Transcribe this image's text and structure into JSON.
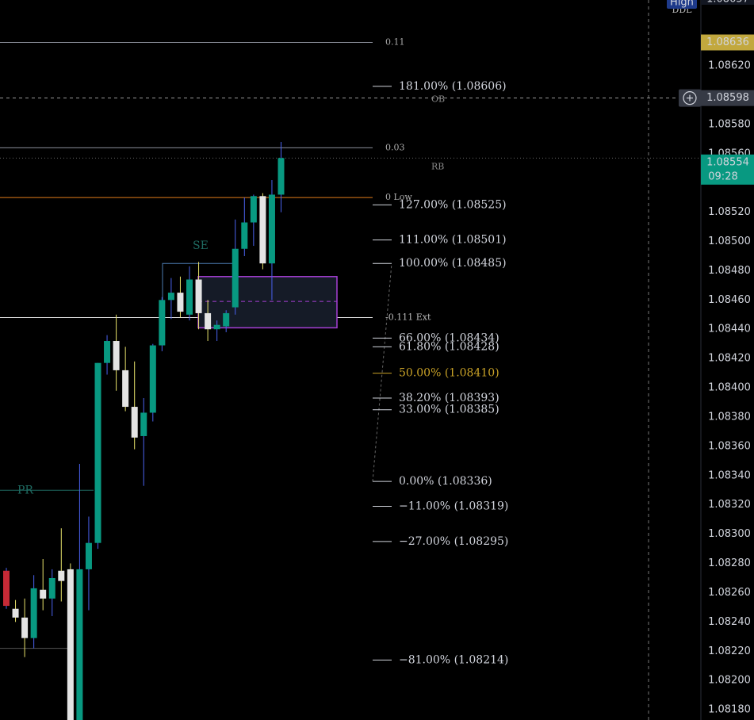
{
  "chart_data": {
    "type": "candlestick",
    "price_range": [
      1.08173,
      1.08665
    ],
    "y_ticks": [
      "1.08620",
      "1.08580",
      "1.08560",
      "1.08520",
      "1.08500",
      "1.08480",
      "1.08460",
      "1.08440",
      "1.08420",
      "1.08400",
      "1.08380",
      "1.08360",
      "1.08340",
      "1.08320",
      "1.08300",
      "1.08280",
      "1.08260",
      "1.08240",
      "1.08220",
      "1.08200",
      "1.08180"
    ],
    "candles": [
      {
        "o": 1.08275,
        "h": 1.08277,
        "l": 1.08249,
        "c": 1.08251,
        "color": "red"
      },
      {
        "o": 1.08249,
        "h": 1.08255,
        "l": 1.0824,
        "c": 1.08243,
        "color": "white"
      },
      {
        "o": 1.08243,
        "h": 1.08256,
        "l": 1.08216,
        "c": 1.08229,
        "color": "white"
      },
      {
        "o": 1.08229,
        "h": 1.08272,
        "l": 1.08222,
        "c": 1.08263,
        "color": "green"
      },
      {
        "o": 1.08262,
        "h": 1.08283,
        "l": 1.08248,
        "c": 1.08256,
        "color": "white"
      },
      {
        "o": 1.08256,
        "h": 1.08276,
        "l": 1.08244,
        "c": 1.0827,
        "color": "green"
      },
      {
        "o": 1.08268,
        "h": 1.08304,
        "l": 1.08254,
        "c": 1.08275,
        "color": "white"
      },
      {
        "o": 1.08276,
        "h": 1.0828,
        "l": 1.08155,
        "c": 1.08165,
        "color": "white"
      },
      {
        "o": 1.08165,
        "h": 1.08348,
        "l": 1.0816,
        "c": 1.08276,
        "color": "green"
      },
      {
        "o": 1.08276,
        "h": 1.08312,
        "l": 1.08248,
        "c": 1.08294,
        "color": "green"
      },
      {
        "o": 1.08294,
        "h": 1.08417,
        "l": 1.0829,
        "c": 1.08417,
        "color": "green"
      },
      {
        "o": 1.08417,
        "h": 1.08436,
        "l": 1.08409,
        "c": 1.08432,
        "color": "green"
      },
      {
        "o": 1.08432,
        "h": 1.0845,
        "l": 1.08398,
        "c": 1.08412,
        "color": "white"
      },
      {
        "o": 1.08412,
        "h": 1.08428,
        "l": 1.08384,
        "c": 1.08387,
        "color": "white"
      },
      {
        "o": 1.08387,
        "h": 1.08418,
        "l": 1.08358,
        "c": 1.08366,
        "color": "white"
      },
      {
        "o": 1.08367,
        "h": 1.08393,
        "l": 1.08333,
        "c": 1.08383,
        "color": "green"
      },
      {
        "o": 1.08383,
        "h": 1.0843,
        "l": 1.08377,
        "c": 1.08429,
        "color": "green"
      },
      {
        "o": 1.08429,
        "h": 1.08462,
        "l": 1.08425,
        "c": 1.0846,
        "color": "green"
      },
      {
        "o": 1.0846,
        "h": 1.08475,
        "l": 1.08447,
        "c": 1.08465,
        "color": "green"
      },
      {
        "o": 1.08465,
        "h": 1.08476,
        "l": 1.08448,
        "c": 1.08452,
        "color": "white"
      },
      {
        "o": 1.0845,
        "h": 1.08483,
        "l": 1.08446,
        "c": 1.08474,
        "color": "green"
      },
      {
        "o": 1.08474,
        "h": 1.08486,
        "l": 1.0844,
        "c": 1.08451,
        "color": "white"
      },
      {
        "o": 1.08451,
        "h": 1.0846,
        "l": 1.08432,
        "c": 1.0844,
        "color": "white"
      },
      {
        "o": 1.0844,
        "h": 1.08446,
        "l": 1.08432,
        "c": 1.08443,
        "color": "green"
      },
      {
        "o": 1.08442,
        "h": 1.08453,
        "l": 1.08438,
        "c": 1.08451,
        "color": "green"
      },
      {
        "o": 1.08455,
        "h": 1.08515,
        "l": 1.0845,
        "c": 1.08495,
        "color": "green"
      },
      {
        "o": 1.08495,
        "h": 1.0853,
        "l": 1.0849,
        "c": 1.08513,
        "color": "green"
      },
      {
        "o": 1.08513,
        "h": 1.08532,
        "l": 1.08497,
        "c": 1.08531,
        "color": "green"
      },
      {
        "o": 1.08531,
        "h": 1.08533,
        "l": 1.08481,
        "c": 1.08485,
        "color": "white"
      },
      {
        "o": 1.08485,
        "h": 1.08542,
        "l": 1.0846,
        "c": 1.08532,
        "color": "green"
      },
      {
        "o": 1.08532,
        "h": 1.08568,
        "l": 1.0852,
        "c": 1.08557,
        "color": "green"
      }
    ],
    "fib_levels": [
      {
        "label": "181.00% (1.08606)",
        "price": 1.08606,
        "color": "#d1d4dc"
      },
      {
        "label": "127.00% (1.08525)",
        "price": 1.08525,
        "color": "#d1d4dc"
      },
      {
        "label": "111.00% (1.08501)",
        "price": 1.08501,
        "color": "#d1d4dc"
      },
      {
        "label": "100.00% (1.08485)",
        "price": 1.08485,
        "color": "#d1d4dc"
      },
      {
        "label": "66.00% (1.08434)",
        "price": 1.08434,
        "color": "#d1d4dc"
      },
      {
        "label": "61.80% (1.08428)",
        "price": 1.08428,
        "color": "#d1d4dc"
      },
      {
        "label": "50.00% (1.08410)",
        "price": 1.0841,
        "color": "#c9a227"
      },
      {
        "label": "38.20% (1.08393)",
        "price": 1.08393,
        "color": "#d1d4dc"
      },
      {
        "label": "33.00% (1.08385)",
        "price": 1.08385,
        "color": "#d1d4dc"
      },
      {
        "label": "0.00% (1.08336)",
        "price": 1.08336,
        "color": "#d1d4dc"
      },
      {
        "label": "−11.00% (1.08319)",
        "price": 1.08319,
        "color": "#d1d4dc"
      },
      {
        "label": "−27.00% (1.08295)",
        "price": 1.08295,
        "color": "#d1d4dc"
      },
      {
        "label": "−81.00% (1.08214)",
        "price": 1.08214,
        "color": "#d1d4dc"
      }
    ],
    "horizontal_lines": [
      {
        "label": "0.11",
        "price": 1.08636,
        "color": "#8a8e99"
      },
      {
        "label": "0.03",
        "price": 1.08564,
        "color": "#8a8e99"
      },
      {
        "label": "0 Low",
        "price": 1.0853,
        "color": "#e07b1a"
      },
      {
        "label": "-0.111 Ext",
        "price": 1.08448,
        "color": "#e8e8e8"
      }
    ],
    "text_labels": [
      {
        "text": "OB",
        "price": 1.08597
      },
      {
        "text": "RB",
        "price": 1.08551
      },
      {
        "text": "SE",
        "price": 1.08497
      },
      {
        "text": "PR",
        "price": 1.0833
      }
    ],
    "price_labels": {
      "high_tag": "High",
      "top_partial": "1.08657",
      "top_partial_sub": "DDL",
      "high_value": "1.08636",
      "crosshair_value": "1.08598",
      "current_price": "1.08554",
      "countdown": "09:28"
    },
    "colors": {
      "up": "#089981",
      "down_red": "#c62a36",
      "down_white": "#e4e4e4",
      "wick_up": "#4a63f0",
      "wick_white": "#e9e36b",
      "box_border": "#a63fd6",
      "box_fill": "#151b27",
      "high_label_bg": "#c2a83e",
      "current_label_bg": "#089981",
      "crosshair_bg": "#363a45"
    }
  }
}
